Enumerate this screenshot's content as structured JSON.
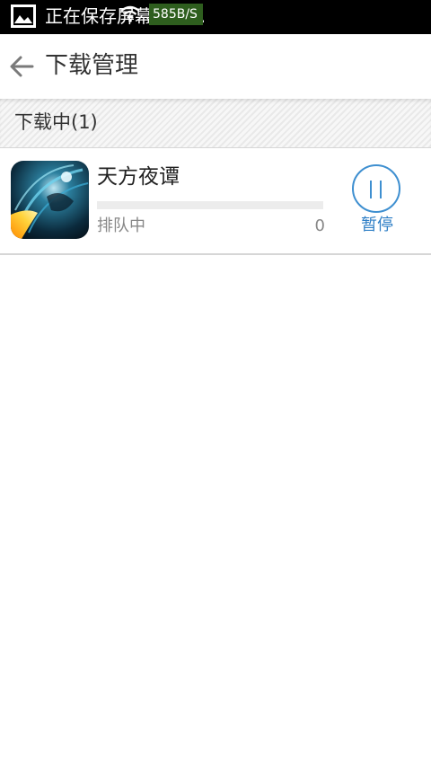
{
  "status_bar": {
    "notification_text": "正在保存屏幕截图...",
    "network_speed": "585B/S"
  },
  "header": {
    "title": "下载管理"
  },
  "section": {
    "title": "下载中(1)"
  },
  "downloads": [
    {
      "name": "天方夜谭",
      "status": "排队中",
      "size": "0",
      "progress": 0,
      "action_label": "暂停"
    }
  ],
  "colors": {
    "accent": "#2f7fc6",
    "progress_track": "#ececec",
    "status_bar_bg": "#000000"
  }
}
